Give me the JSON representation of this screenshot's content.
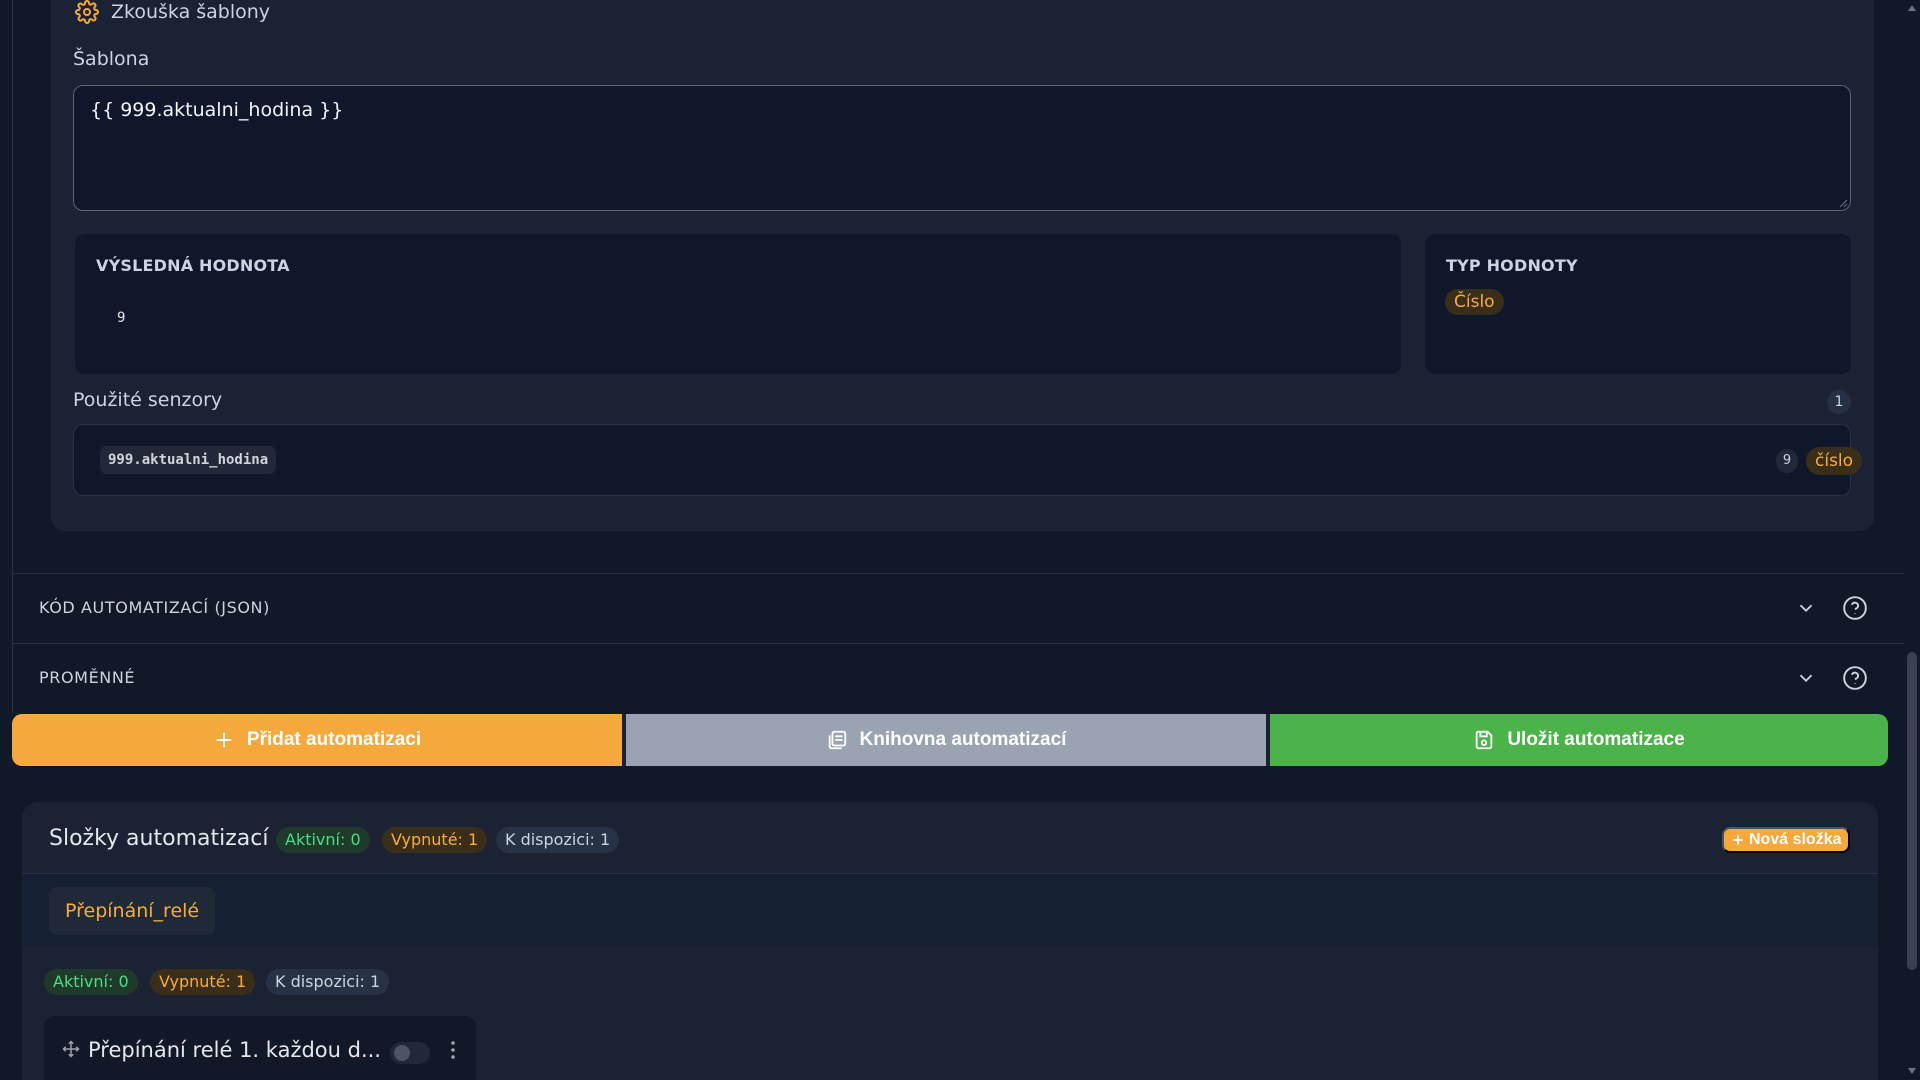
{
  "test": {
    "title": "Zkouška šablony",
    "template_label": "Šablona",
    "template_value": "{{ 999.aktualni_hodina }}",
    "result_heading": "VÝSLEDNÁ HODNOTA",
    "result_value": "9",
    "type_heading": "TYP HODNOTY",
    "type_value": "Číslo",
    "sensors_label": "Použité senzory",
    "sensors_count": "1",
    "sensors": [
      {
        "key": "999.aktualni_hodina",
        "value": "9",
        "type": "číslo"
      }
    ]
  },
  "accordion": {
    "json_label": "KÓD AUTOMATIZACÍ (JSON)",
    "vars_label": "PROMĚNNÉ"
  },
  "actions": {
    "add": "Přidat automatizaci",
    "library": "Knihovna automatizací",
    "save": "Uložit automatizace"
  },
  "folders": {
    "title": "Složky automatizací",
    "active": "Aktivní: 0",
    "disabled": "Vypnuté: 1",
    "available": "K dispozici: 1",
    "new_folder": "Nová složka",
    "tabs": [
      "Přepínání_relé"
    ],
    "folder_active": "Aktivní: 0",
    "folder_disabled": "Vypnuté: 1",
    "folder_available": "K dispozici: 1",
    "automations": [
      {
        "name": "Přepínání relé 1. každou d...",
        "enabled": false
      }
    ]
  },
  "colors": {
    "background": "#111827",
    "card": "#1a2233",
    "accent_orange": "#f5a83b",
    "save_green": "#4cb24a",
    "library_gray": "#9aa3b2"
  },
  "icons": {
    "test_header": "gear-icon",
    "add": "plus-icon",
    "library": "library-icon",
    "save": "save-icon",
    "accordion": [
      "chevron-down-icon",
      "help-icon"
    ],
    "drag": "move-icon",
    "menu": "kebab-icon"
  }
}
